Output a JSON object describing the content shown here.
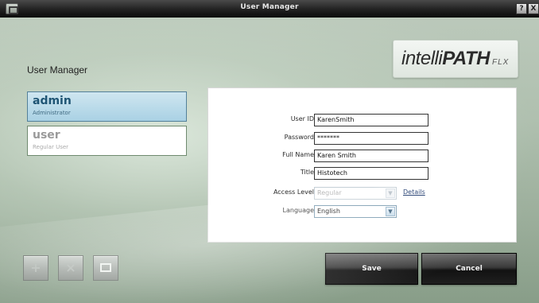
{
  "window": {
    "title": "User Manager",
    "help_label": "?",
    "close_label": "X"
  },
  "logo": {
    "part1": "intelli",
    "part2": "PATH",
    "part3": "FLX"
  },
  "page": {
    "heading": "User Manager"
  },
  "users": [
    {
      "name": "admin",
      "role": "Administrator",
      "selected": true
    },
    {
      "name": "user",
      "role": "Regular User",
      "selected": false
    }
  ],
  "form": {
    "user_id": {
      "label": "User ID",
      "value": "KarenSmith"
    },
    "password": {
      "label": "Password",
      "value": "*******"
    },
    "full_name": {
      "label": "Full Name",
      "value": "Karen Smith"
    },
    "title": {
      "label": "Title",
      "value": "Histotech"
    },
    "access_level": {
      "label": "Access Level",
      "value": "Regular",
      "disabled": true,
      "details_label": "Details"
    },
    "language": {
      "label": "Language",
      "value": "English"
    }
  },
  "toolbar": {
    "add_label": "+",
    "delete_label": "×",
    "edit_icon": "edit-icon"
  },
  "actions": {
    "save_label": "Save",
    "cancel_label": "Cancel"
  }
}
